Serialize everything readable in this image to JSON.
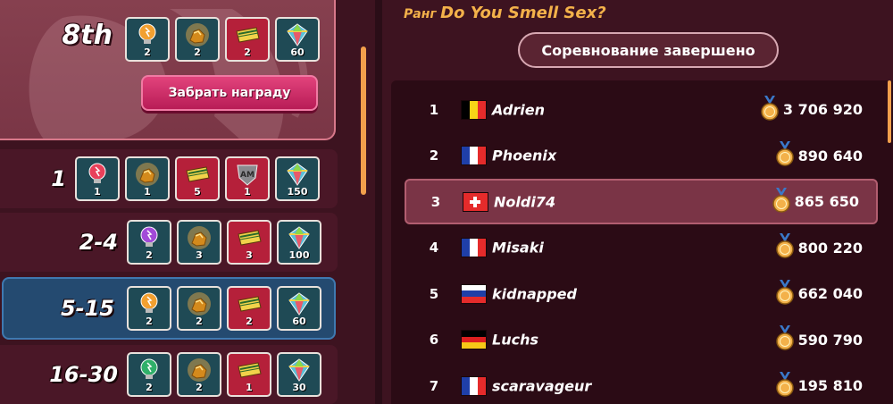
{
  "my_reward": {
    "rank": "8th",
    "items": [
      {
        "icon": "orange-bulb-icon",
        "qty": "2",
        "bg": "teal"
      },
      {
        "icon": "gold-nugget-icon",
        "qty": "2",
        "bg": "teal"
      },
      {
        "icon": "gift-box-icon",
        "qty": "2",
        "bg": "red"
      },
      {
        "icon": "rainbow-gem-icon",
        "qty": "60",
        "bg": "teal"
      }
    ],
    "claim_label": "Забрать награду"
  },
  "tiers": [
    {
      "range": "1",
      "items": [
        {
          "icon": "red-bulb-icon",
          "qty": "1",
          "bg": "teal"
        },
        {
          "icon": "gold-nugget-icon",
          "qty": "1",
          "bg": "teal"
        },
        {
          "icon": "gift-box-icon",
          "qty": "5",
          "bg": "red"
        },
        {
          "icon": "am-shield-icon",
          "qty": "1",
          "bg": "red"
        },
        {
          "icon": "rainbow-gem-icon",
          "qty": "150",
          "bg": "teal"
        }
      ]
    },
    {
      "range": "2-4",
      "items": [
        {
          "icon": "purple-bulb-icon",
          "qty": "2",
          "bg": "teal"
        },
        {
          "icon": "gold-nugget-icon",
          "qty": "3",
          "bg": "teal"
        },
        {
          "icon": "gift-box-icon",
          "qty": "3",
          "bg": "red"
        },
        {
          "icon": "rainbow-gem-icon",
          "qty": "100",
          "bg": "teal"
        }
      ]
    },
    {
      "range": "5-15",
      "items": [
        {
          "icon": "orange-bulb-icon",
          "qty": "2",
          "bg": "teal"
        },
        {
          "icon": "gold-nugget-icon",
          "qty": "2",
          "bg": "teal"
        },
        {
          "icon": "gift-box-icon",
          "qty": "2",
          "bg": "red"
        },
        {
          "icon": "rainbow-gem-icon",
          "qty": "60",
          "bg": "teal"
        }
      ]
    },
    {
      "range": "16-30",
      "items": [
        {
          "icon": "green-bulb-icon",
          "qty": "2",
          "bg": "teal"
        },
        {
          "icon": "gold-nugget-icon",
          "qty": "2",
          "bg": "teal"
        },
        {
          "icon": "gift-box-icon",
          "qty": "1",
          "bg": "red"
        },
        {
          "icon": "rainbow-gem-icon",
          "qty": "30",
          "bg": "teal"
        }
      ]
    }
  ],
  "header": {
    "rank_label": "Ранг",
    "rank_name": "Do You Smell Sex?",
    "status": "Соревнование завершено"
  },
  "leaderboard": [
    {
      "pos": "1",
      "flag": "belgium",
      "name": "Adrien",
      "score": "3 706 920"
    },
    {
      "pos": "2",
      "flag": "france",
      "name": "Phoenix",
      "score": "890 640"
    },
    {
      "pos": "3",
      "flag": "switzerland",
      "name": "Noldi74",
      "score": "865 650",
      "me": true
    },
    {
      "pos": "4",
      "flag": "france",
      "name": "Misaki",
      "score": "800 220"
    },
    {
      "pos": "5",
      "flag": "russia",
      "name": "kidnapped",
      "score": "662 040"
    },
    {
      "pos": "6",
      "flag": "germany",
      "name": "Luchs",
      "score": "590 790"
    },
    {
      "pos": "7",
      "flag": "france",
      "name": "scaravageur",
      "score": "195 810"
    }
  ],
  "colors": {
    "accent_gold": "#f3b14a",
    "claim_button": "#d12a66",
    "active_tier": "#244a70"
  }
}
